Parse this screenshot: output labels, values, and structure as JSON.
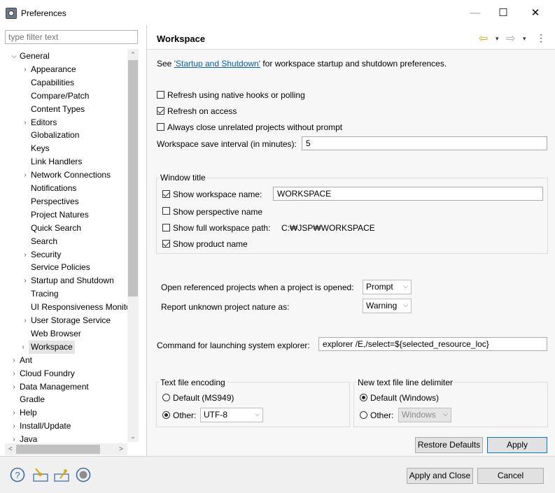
{
  "window": {
    "title": "Preferences",
    "minimize": "—",
    "maximize": "☐",
    "close": "✕"
  },
  "filter": {
    "placeholder": "type filter text"
  },
  "tree": {
    "items": [
      {
        "label": "General",
        "twisty": "⌵",
        "level": 0
      },
      {
        "label": "Appearance",
        "twisty": "›",
        "level": 1
      },
      {
        "label": "Capabilities",
        "twisty": "",
        "level": 1
      },
      {
        "label": "Compare/Patch",
        "twisty": "",
        "level": 1
      },
      {
        "label": "Content Types",
        "twisty": "",
        "level": 1
      },
      {
        "label": "Editors",
        "twisty": "›",
        "level": 1
      },
      {
        "label": "Globalization",
        "twisty": "",
        "level": 1
      },
      {
        "label": "Keys",
        "twisty": "",
        "level": 1
      },
      {
        "label": "Link Handlers",
        "twisty": "",
        "level": 1
      },
      {
        "label": "Network Connections",
        "twisty": "›",
        "level": 1
      },
      {
        "label": "Notifications",
        "twisty": "",
        "level": 1
      },
      {
        "label": "Perspectives",
        "twisty": "",
        "level": 1
      },
      {
        "label": "Project Natures",
        "twisty": "",
        "level": 1
      },
      {
        "label": "Quick Search",
        "twisty": "",
        "level": 1
      },
      {
        "label": "Search",
        "twisty": "",
        "level": 1
      },
      {
        "label": "Security",
        "twisty": "›",
        "level": 1
      },
      {
        "label": "Service Policies",
        "twisty": "",
        "level": 1
      },
      {
        "label": "Startup and Shutdown",
        "twisty": "›",
        "level": 1
      },
      {
        "label": "Tracing",
        "twisty": "",
        "level": 1
      },
      {
        "label": "UI Responsiveness Monito",
        "twisty": "",
        "level": 1
      },
      {
        "label": "User Storage Service",
        "twisty": "›",
        "level": 1
      },
      {
        "label": "Web Browser",
        "twisty": "",
        "level": 1
      },
      {
        "label": "Workspace",
        "twisty": "›",
        "level": 1,
        "selected": true
      },
      {
        "label": "Ant",
        "twisty": "›",
        "level": 0
      },
      {
        "label": "Cloud Foundry",
        "twisty": "›",
        "level": 0
      },
      {
        "label": "Data Management",
        "twisty": "›",
        "level": 0
      },
      {
        "label": "Gradle",
        "twisty": "",
        "level": 0
      },
      {
        "label": "Help",
        "twisty": "›",
        "level": 0
      },
      {
        "label": "Install/Update",
        "twisty": "›",
        "level": 0
      },
      {
        "label": "Java",
        "twisty": "›",
        "level": 0
      }
    ],
    "scroll_up": "⌃",
    "scroll_down": "⌄",
    "scroll_left": "<",
    "scroll_right": ">"
  },
  "page": {
    "title": "Workspace",
    "nav_back": "⇦",
    "nav_forward": "⇨",
    "nav_dropdown": "▾",
    "nav_menu": "⋮",
    "intro_prefix": "See ",
    "intro_link": "'Startup and Shutdown'",
    "intro_suffix": " for workspace startup and shutdown preferences.",
    "refresh_native": {
      "label": "Refresh using native hooks or polling",
      "checked": false
    },
    "refresh_access": {
      "label": "Refresh on access",
      "checked": true
    },
    "always_close": {
      "label": "Always close unrelated projects without prompt",
      "checked": false
    },
    "save_interval": {
      "label": "Workspace save interval (in minutes):",
      "value": "5"
    },
    "window_title": {
      "group_label": "Window title",
      "show_workspace_name": {
        "label": "Show workspace name:",
        "checked": true,
        "value": "WORKSPACE"
      },
      "show_perspective_name": {
        "label": "Show perspective name",
        "checked": false
      },
      "show_full_path": {
        "label": "Show full workspace path:",
        "checked": false,
        "path": "C:₩JSP₩WORKSPACE"
      },
      "show_product_name": {
        "label": "Show product name",
        "checked": true
      }
    },
    "open_referenced": {
      "label": "Open referenced projects when a project is opened:",
      "value": "Prompt"
    },
    "report_unknown": {
      "label": "Report unknown project nature as:",
      "value": "Warning"
    },
    "explorer_command": {
      "label": "Command for launching system explorer:",
      "value": "explorer /E,/select=${selected_resource_loc}"
    },
    "encoding": {
      "group_label": "Text file encoding",
      "default_label": "Default (MS949)",
      "other_label": "Other:",
      "other_value": "UTF-8",
      "selected": "other"
    },
    "line_delimiter": {
      "group_label": "New text file line delimiter",
      "default_label": "Default (Windows)",
      "other_label": "Other:",
      "other_value": "Windows",
      "selected": "default"
    },
    "restore_defaults": "Restore Defaults",
    "apply": "Apply"
  },
  "footer": {
    "help_icon": "?",
    "import_icon": "import-icon",
    "export_icon": "export-icon",
    "record_icon": "record-icon",
    "apply_and_close": "Apply and Close",
    "cancel": "Cancel"
  },
  "colors": {
    "accent": "#0078d7",
    "link": "#0b5cad",
    "nav_arrow": "#e0a300"
  }
}
